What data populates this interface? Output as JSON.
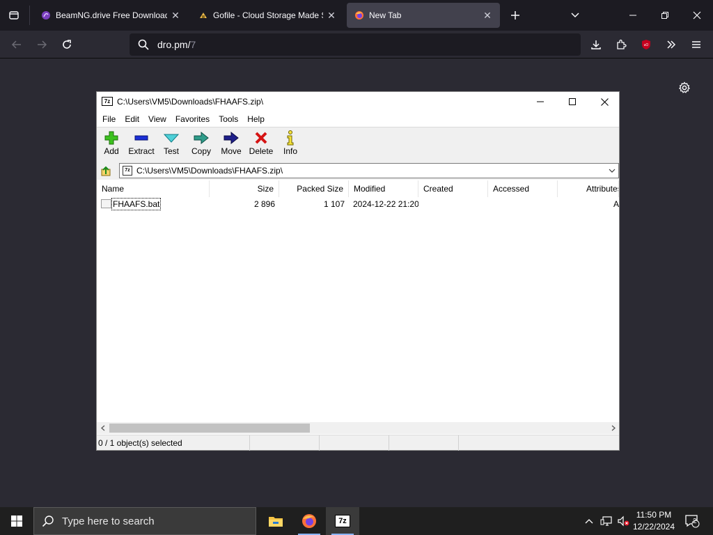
{
  "browser": {
    "tabs": [
      {
        "title": "BeamNG.drive Free Download (",
        "icon": "beamng-favicon"
      },
      {
        "title": "Gofile - Cloud Storage Made Si",
        "icon": "gofile-favicon"
      },
      {
        "title": "New Tab",
        "icon": "firefox-favicon",
        "active": true
      }
    ],
    "url_host": "dro.pm/",
    "url_path": "7"
  },
  "zip": {
    "title": "C:\\Users\\VM5\\Downloads\\FHAAFS.zip\\",
    "app_icon_text": "7z",
    "menu": [
      "File",
      "Edit",
      "View",
      "Favorites",
      "Tools",
      "Help"
    ],
    "toolbar": [
      "Add",
      "Extract",
      "Test",
      "Copy",
      "Move",
      "Delete",
      "Info"
    ],
    "address": "C:\\Users\\VM5\\Downloads\\FHAAFS.zip\\",
    "columns": [
      "Name",
      "Size",
      "Packed Size",
      "Modified",
      "Created",
      "Accessed",
      "Attributes"
    ],
    "rows": [
      {
        "name": "FHAAFS.bat",
        "size": "2 896",
        "packed": "1 107",
        "modified": "2024-12-22 21:20",
        "created": "",
        "accessed": "",
        "attr": "A"
      }
    ],
    "status": "0 / 1 object(s) selected"
  },
  "taskbar": {
    "search_placeholder": "Type here to search",
    "time": "11:50 PM",
    "date": "12/22/2024",
    "notifications": "2"
  },
  "colors": {
    "firefox_bg": "#2b2a33",
    "tabstrip": "#1c1b22",
    "taskbar": "#1f1f1f"
  }
}
